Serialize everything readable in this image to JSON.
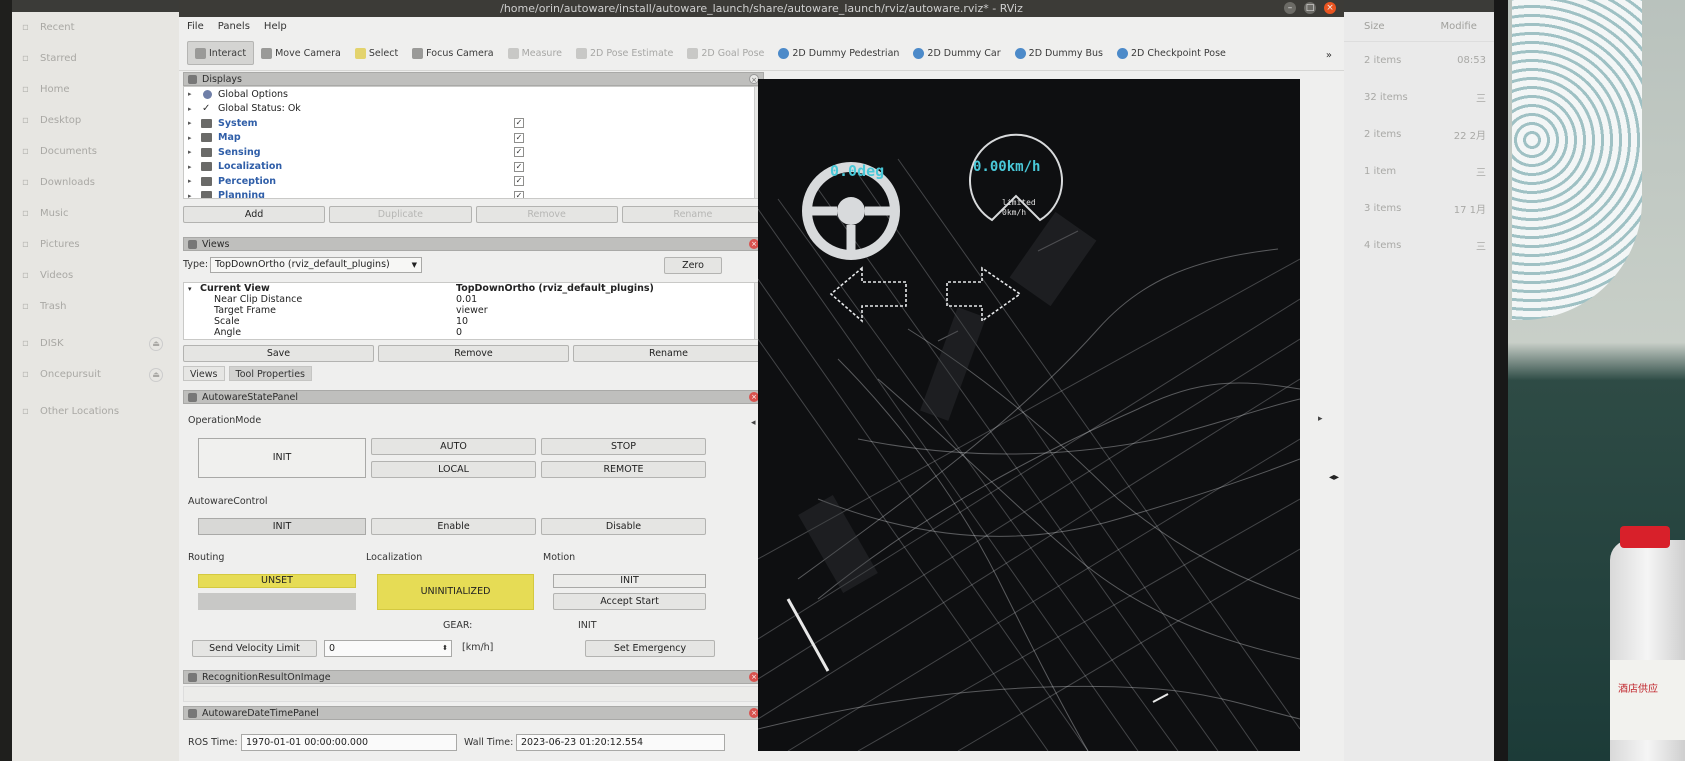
{
  "nautilus_sidebar": [
    {
      "label": "Recent",
      "icon": "clock-icon"
    },
    {
      "label": "Starred",
      "icon": "star-icon"
    },
    {
      "label": "Home",
      "icon": "home-icon"
    },
    {
      "label": "Desktop",
      "icon": "desktop-icon"
    },
    {
      "label": "Documents",
      "icon": "document-icon"
    },
    {
      "label": "Downloads",
      "icon": "download-icon"
    },
    {
      "label": "Music",
      "icon": "music-icon"
    },
    {
      "label": "Pictures",
      "icon": "picture-icon"
    },
    {
      "label": "Videos",
      "icon": "video-icon"
    },
    {
      "label": "Trash",
      "icon": "trash-icon"
    },
    {
      "label": "DISK",
      "icon": "drive-icon",
      "eject": true
    },
    {
      "label": "Oncepursuit",
      "icon": "drive-icon",
      "eject": true
    },
    {
      "label": "Other Locations",
      "icon": "plus-icon"
    }
  ],
  "nautilus_main": {
    "col_size": "Size",
    "col_modified": "Modifie",
    "rows": [
      {
        "size": "2 items",
        "modified": "08:53"
      },
      {
        "size": "32 items",
        "modified": "三"
      },
      {
        "size": "2 items",
        "modified": "22 2月"
      },
      {
        "size": "1 item",
        "modified": "三"
      },
      {
        "size": "3 items",
        "modified": "17 1月"
      },
      {
        "size": "4 items",
        "modified": "三"
      }
    ]
  },
  "window": {
    "title": "/home/orin/autoware/install/autoware_launch/share/autoware_launch/rviz/autoware.rviz* - RViz",
    "menu": [
      "File",
      "Panels",
      "Help"
    ]
  },
  "toolbar": {
    "tools": [
      {
        "label": "Interact",
        "active": true,
        "dim": false,
        "icon": "grey"
      },
      {
        "label": "Move Camera",
        "active": false,
        "dim": false,
        "icon": "grey"
      },
      {
        "label": "Select",
        "active": false,
        "dim": false,
        "icon": "yellow"
      },
      {
        "label": "Focus Camera",
        "active": false,
        "dim": false,
        "icon": "grey"
      },
      {
        "label": "Measure",
        "active": false,
        "dim": true,
        "icon": "grey"
      },
      {
        "label": "2D Pose Estimate",
        "active": false,
        "dim": true,
        "icon": "grey"
      },
      {
        "label": "2D Goal Pose",
        "active": false,
        "dim": true,
        "icon": "grey"
      },
      {
        "label": "2D Dummy Pedestrian",
        "active": false,
        "dim": false,
        "icon": "blue"
      },
      {
        "label": "2D Dummy Car",
        "active": false,
        "dim": false,
        "icon": "blue"
      },
      {
        "label": "2D Dummy Bus",
        "active": false,
        "dim": false,
        "icon": "blue"
      },
      {
        "label": "2D Checkpoint Pose",
        "active": false,
        "dim": false,
        "icon": "blue"
      }
    ],
    "more": "»"
  },
  "displays": {
    "title": "Displays",
    "items": [
      {
        "label": "Global Options",
        "kind": "dot",
        "checked": null
      },
      {
        "label": "Global Status: Ok",
        "kind": "check",
        "checked": null
      },
      {
        "label": "System",
        "kind": "folder",
        "checked": true
      },
      {
        "label": "Map",
        "kind": "folder",
        "checked": true
      },
      {
        "label": "Sensing",
        "kind": "folder",
        "checked": true
      },
      {
        "label": "Localization",
        "kind": "folder",
        "checked": true
      },
      {
        "label": "Perception",
        "kind": "folder",
        "checked": true
      },
      {
        "label": "Planning",
        "kind": "folder",
        "checked": true
      }
    ],
    "buttons": [
      "Add",
      "Duplicate",
      "Remove",
      "Rename"
    ]
  },
  "views": {
    "title": "Views",
    "type_label": "Type:",
    "type_value": "TopDownOrtho (rviz_default_plugins)",
    "zero": "Zero",
    "props": [
      {
        "key": "Current View",
        "value": "TopDownOrtho (rviz_default_plugins)",
        "bold": true
      },
      {
        "key": "Near Clip Distance",
        "value": "0.01"
      },
      {
        "key": "Target Frame",
        "value": "viewer"
      },
      {
        "key": "Scale",
        "value": "10"
      },
      {
        "key": "Angle",
        "value": "0"
      }
    ],
    "buttons": [
      "Save",
      "Remove",
      "Rename"
    ],
    "tabs": [
      "Views",
      "Tool Properties"
    ]
  },
  "state_panel": {
    "title": "AutowareStatePanel",
    "operation_mode_label": "OperationMode",
    "operation_mode_state": "INIT",
    "op_buttons": [
      "AUTO",
      "STOP",
      "LOCAL",
      "REMOTE"
    ],
    "autoware_control_label": "AutowareControl",
    "autoware_control_state": "INIT",
    "control_buttons": [
      "Enable",
      "Disable"
    ],
    "routing_label": "Routing",
    "routing_state": "UNSET",
    "localization_label": "Localization",
    "localization_state": "UNINITIALIZED",
    "motion_label": "Motion",
    "motion_state": "INIT",
    "accept_start": "Accept Start",
    "gear_label": "GEAR:",
    "init_label": "INIT",
    "velocity_button": "Send Velocity Limit",
    "velocity_value": "0",
    "velocity_unit": "[km/h]",
    "emergency_button": "Set Emergency"
  },
  "recognition_panel": {
    "title": "RecognitionResultOnImage"
  },
  "datetime_panel": {
    "title": "AutowareDateTimePanel",
    "ros_label": "ROS Time:",
    "ros_value": "1970-01-01 00:00:00.000",
    "wall_label": "Wall Time:",
    "wall_value": "2023-06-23 01:20:12.554"
  },
  "viewport": {
    "steering": "0.0deg",
    "speed": "0.00km/h",
    "limited_label": "limited",
    "limited_value": "0km/h",
    "accent": "#49c8d8"
  },
  "bottle_label": "酒店供应"
}
